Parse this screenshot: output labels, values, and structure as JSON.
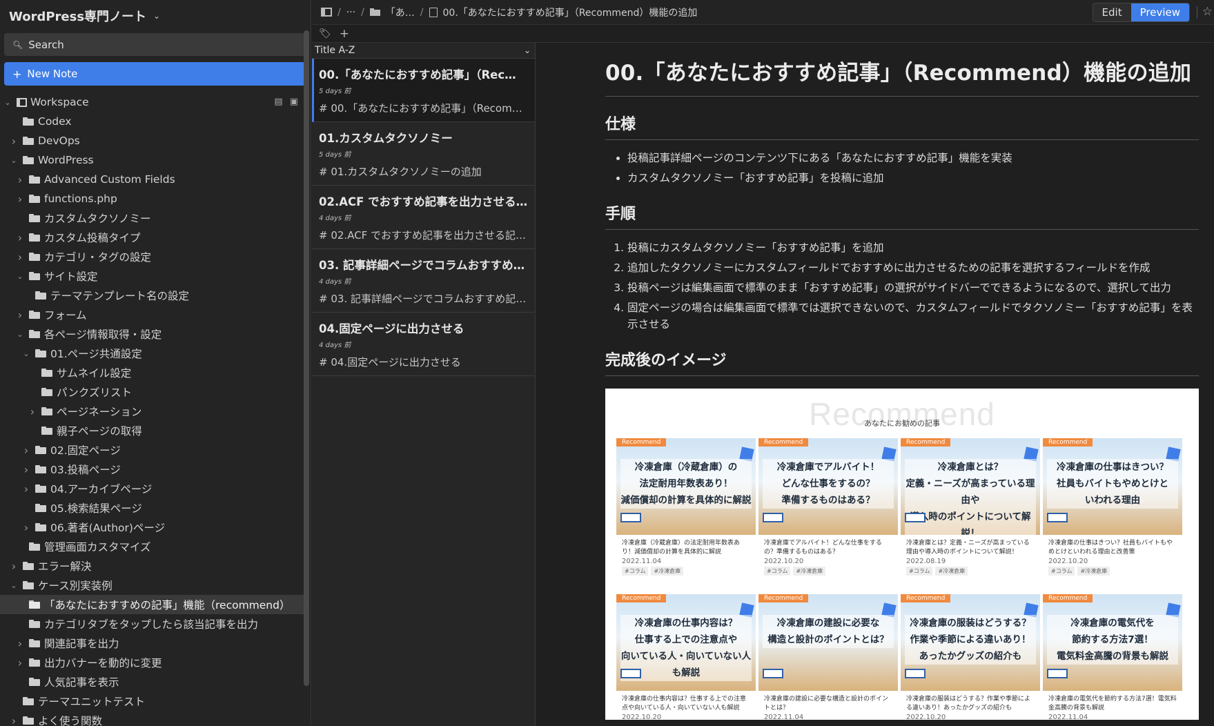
{
  "workspace_title": "WordPress専門ノート",
  "search": {
    "label": "Search"
  },
  "new_note": {
    "label": "New Note"
  },
  "tree": [
    {
      "label": "Workspace",
      "depth": 0,
      "caret": "v",
      "kind": "workspace"
    },
    {
      "label": "Codex",
      "depth": 1,
      "caret": "",
      "kind": "folder"
    },
    {
      "label": "DevOps",
      "depth": 1,
      "caret": ">",
      "kind": "folder"
    },
    {
      "label": "WordPress",
      "depth": 1,
      "caret": "v",
      "kind": "folder"
    },
    {
      "label": "Advanced Custom Fields",
      "depth": 2,
      "caret": ">",
      "kind": "folder"
    },
    {
      "label": "functions.php",
      "depth": 2,
      "caret": ">",
      "kind": "folder"
    },
    {
      "label": "カスタムタクソノミー",
      "depth": 2,
      "caret": "",
      "kind": "folder"
    },
    {
      "label": "カスタム投稿タイプ",
      "depth": 2,
      "caret": ">",
      "kind": "folder"
    },
    {
      "label": "カテゴリ・タグの設定",
      "depth": 2,
      "caret": ">",
      "kind": "folder"
    },
    {
      "label": "サイト設定",
      "depth": 2,
      "caret": "v",
      "kind": "folder"
    },
    {
      "label": "テーマテンプレート名の設定",
      "depth": 3,
      "caret": "",
      "kind": "folder"
    },
    {
      "label": "フォーム",
      "depth": 2,
      "caret": ">",
      "kind": "folder"
    },
    {
      "label": "各ページ情報取得・設定",
      "depth": 2,
      "caret": "v",
      "kind": "folder"
    },
    {
      "label": "01.ページ共通設定",
      "depth": 3,
      "caret": "v",
      "kind": "folder"
    },
    {
      "label": "サムネイル設定",
      "depth": 4,
      "caret": "",
      "kind": "folder"
    },
    {
      "label": "パンクズリスト",
      "depth": 4,
      "caret": "",
      "kind": "folder"
    },
    {
      "label": "ページネーション",
      "depth": 4,
      "caret": ">",
      "kind": "folder"
    },
    {
      "label": "親子ページの取得",
      "depth": 4,
      "caret": "",
      "kind": "folder"
    },
    {
      "label": "02.固定ページ",
      "depth": 3,
      "caret": ">",
      "kind": "folder"
    },
    {
      "label": "03.投稿ページ",
      "depth": 3,
      "caret": ">",
      "kind": "folder"
    },
    {
      "label": "04.アーカイブページ",
      "depth": 3,
      "caret": ">",
      "kind": "folder"
    },
    {
      "label": "05.検索結果ページ",
      "depth": 3,
      "caret": "",
      "kind": "folder"
    },
    {
      "label": "06.著者(Author)ページ",
      "depth": 3,
      "caret": ">",
      "kind": "folder"
    },
    {
      "label": "管理画面カスタマイズ",
      "depth": 2,
      "caret": "",
      "kind": "folder"
    },
    {
      "label": "エラー解決",
      "depth": 1,
      "caret": ">",
      "kind": "folder"
    },
    {
      "label": "ケース別実装例",
      "depth": 1,
      "caret": "v",
      "kind": "folder"
    },
    {
      "label": "「あなたにおすすめの記事」機能（recommend）",
      "depth": 2,
      "caret": "",
      "kind": "folder-open",
      "selected": true
    },
    {
      "label": "カテゴリタブをタップしたら該当記事を出力",
      "depth": 2,
      "caret": "",
      "kind": "folder"
    },
    {
      "label": "関連記事を出力",
      "depth": 2,
      "caret": ">",
      "kind": "folder"
    },
    {
      "label": "出力バナーを動的に変更",
      "depth": 2,
      "caret": ">",
      "kind": "folder"
    },
    {
      "label": "人気記事を表示",
      "depth": 2,
      "caret": "",
      "kind": "folder"
    },
    {
      "label": "テーマユニットテスト",
      "depth": 1,
      "caret": "",
      "kind": "folder"
    },
    {
      "label": "よく使う関数",
      "depth": 1,
      "caret": ">",
      "kind": "folder"
    }
  ],
  "breadcrumb": {
    "ellipsis": "···",
    "folder": "「あ…",
    "note": "00.「あなたにおすすめ記事」（Recommend）機能の追加"
  },
  "mode": {
    "edit": "Edit",
    "preview": "Preview"
  },
  "sort": {
    "label": "Title A-Z"
  },
  "notes": [
    {
      "title": "00.「あなたにおすすめ記事」（Rec…",
      "date": "5 days 前",
      "excerpt": "# 00.「あなたにおすすめ記事」（Recom…",
      "active": true
    },
    {
      "title": "01.カスタムタクソノミー",
      "date": "5 days 前",
      "excerpt": "# 01.カスタムタクソノミーの追加"
    },
    {
      "title": "02.ACF でおすすめ記事を出力させる…",
      "date": "4 days 前",
      "excerpt": "# 02.ACF でおすすめ記事を出力させる記…"
    },
    {
      "title": "03. 記事詳細ページでコラムおすすめ…",
      "date": "4 days 前",
      "excerpt": "# 03. 記事詳細ページでコラムおすすめ記…"
    },
    {
      "title": "04.固定ページに出力させる",
      "date": "4 days 前",
      "excerpt": "# 04.固定ページに出力させる"
    }
  ],
  "doc": {
    "h1": "00.「あなたにおすすめ記事」（Recommend）機能の追加",
    "spec_heading": "仕様",
    "spec_items": [
      "投稿記事詳細ページのコンテンツ下にある「あなたにおすすめ記事」機能を実装",
      "カスタムタクソノミー「おすすめ記事」を投稿に追加"
    ],
    "steps_heading": "手順",
    "steps": [
      "投稿にカスタムタクソノミー「おすすめ記事」を追加",
      "追加したタクソノミーにカスタムフィールドでおすすめに出力させるための記事を選択するフィールドを作成",
      "投稿ページは編集画面で標準のまま「おすすめ記事」の選択がサイドバーでできるようになるので、選択して出力",
      "固定ページの場合は編集画面で標準では選択できないので、カスタムフィールドでタクソノミー「おすすめ記事」を表示させる"
    ],
    "image_heading": "完成後のイメージ",
    "image": {
      "title": "Recommend",
      "subtitle": "あなたにお勧めの記事",
      "badge": "Recommend",
      "cards": [
        {
          "text": "冷凍倉庫（冷蔵倉庫）の\n法定耐用年数表あり！\n減価償却の計算を具体的に解説",
          "caption": "冷凍倉庫（冷蔵倉庫）の法定耐用年数表あり！減価償却の計算を具体的に解説",
          "date": "2022.11.04",
          "tags": [
            "#コラム",
            "#冷凍倉庫"
          ]
        },
        {
          "text": "冷凍倉庫でアルバイト！\nどんな仕事をするの？\n準備するものはある？",
          "caption": "冷凍倉庫でアルバイト！どんな仕事をするの？準備するものはある？",
          "date": "2022.10.20",
          "tags": [
            "#コラム",
            "#冷凍倉庫"
          ]
        },
        {
          "text": "冷凍倉庫とは？\n定義・ニーズが高まっている理由や\n導入時のポイントについて解説！",
          "caption": "冷凍倉庫とは？定義・ニーズが高まっている理由や導入時のポイントについて解説！",
          "date": "2022.08.19",
          "tags": [
            "#コラム",
            "#冷凍倉庫"
          ]
        },
        {
          "text": "冷凍倉庫の仕事はきつい？\n社員もバイトもやめとけと\nいわれる理由",
          "caption": "冷凍倉庫の仕事はきつい？社員もバイトもやめとけといわれる理由と改善策",
          "date": "2022.10.20",
          "tags": [
            "#コラム",
            "#冷凍倉庫"
          ]
        },
        {
          "text": "冷凍倉庫の仕事内容は？\n仕事する上での注意点や\n向いている人・向いていない人も解説",
          "caption": "冷凍倉庫の仕事内容は？仕事する上での注意点や向いている人・向いていない人も解説",
          "date": "2022.10.20",
          "tags": []
        },
        {
          "text": "冷凍倉庫の建設に必要な\n構造と設計のポイントとは？",
          "caption": "冷凍倉庫の建設に必要な構造と設計のポイントとは？",
          "date": "2022.11.04",
          "tags": []
        },
        {
          "text": "冷凍倉庫の服装はどうする？\n作業や季節による違いあり！\nあったかグッズの紹介も",
          "caption": "冷凍倉庫の服装はどうする？作業や季節による違いあり！あったかグッズの紹介も",
          "date": "2022.10.20",
          "tags": []
        },
        {
          "text": "冷凍倉庫の電気代を\n節約する方法7選！\n電気料金高騰の背景も解説",
          "caption": "冷凍倉庫の電気代を節約する方法7選！電気料金高騰の背景も解説",
          "date": "2022.11.04",
          "tags": []
        }
      ]
    }
  }
}
